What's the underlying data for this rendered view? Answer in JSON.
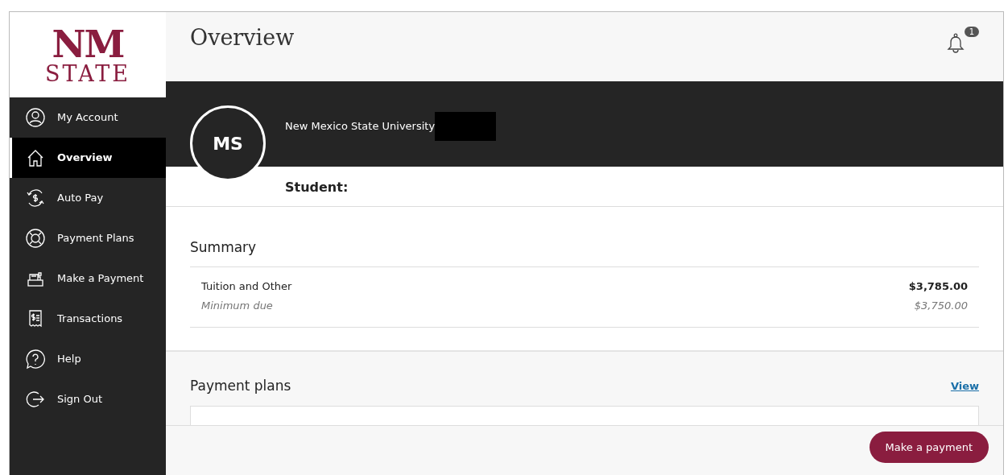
{
  "logo": {
    "line_1": "NM",
    "line_2": "STATE"
  },
  "sidebar": {
    "items": [
      {
        "label": "My Account",
        "kind": "person",
        "selected": false
      },
      {
        "label": "Overview",
        "kind": "home",
        "selected": true
      },
      {
        "label": "Auto Pay",
        "kind": "autopay",
        "selected": false
      },
      {
        "label": "Payment Plans",
        "kind": "lifebuoy",
        "selected": false
      },
      {
        "label": "Make a Payment",
        "kind": "register",
        "selected": false
      },
      {
        "label": "Transactions",
        "kind": "receipt",
        "selected": false
      },
      {
        "label": "Help",
        "kind": "help",
        "selected": false
      },
      {
        "label": "Sign Out",
        "kind": "signout",
        "selected": false
      }
    ]
  },
  "header": {
    "title": "Overview",
    "notifications": "1"
  },
  "profile": {
    "initials": "MS",
    "institution": "New Mexico State University",
    "student_label": "Student:"
  },
  "summary": {
    "title": "Summary",
    "rows": [
      {
        "label": "Tuition and Other",
        "amount": "$3,785.00",
        "kind": "total"
      },
      {
        "label": "Minimum due",
        "amount": "$3,750.00",
        "kind": "minimum"
      }
    ]
  },
  "payment_plans": {
    "title": "Payment plans",
    "link": "View"
  },
  "footer": {
    "button": "Make a payment"
  }
}
